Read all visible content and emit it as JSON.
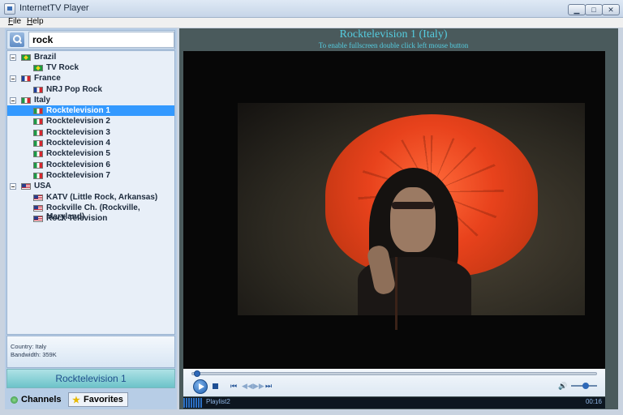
{
  "window": {
    "title": "InternetTV Player"
  },
  "menu": [
    "File",
    "Help"
  ],
  "search": {
    "value": "rock"
  },
  "tree": {
    "brazil": "Brazil",
    "tvrock": "TV Rock",
    "france": "France",
    "nrj": "NRJ Pop Rock",
    "italy": "Italy",
    "rt1": "Rocktelevision 1",
    "rt2": "Rocktelevision 2",
    "rt3": "Rocktelevision 3",
    "rt4": "Rocktelevision 4",
    "rt5": "Rocktelevision 5",
    "rt6": "Rocktelevision 6",
    "rt7": "Rocktelevision 7",
    "usa": "USA",
    "katv": "KATV (Little Rock, Arkansas)",
    "rockville": "Rockville Ch. (Rockville, Maryland)",
    "rocktv": "Rock Television"
  },
  "info": {
    "country": "Country: Italy",
    "bandwidth": "Bandwidth: 359K"
  },
  "now_playing": "Rocktelevision 1",
  "tabs": {
    "channels": "Channels",
    "favorites": "Favorites"
  },
  "player": {
    "title": "Rocktelevision 1 (Italy)",
    "hint": "To enable fullscreen double click left mouse button",
    "prev": "⏮",
    "rew": "◀◀",
    "ffw": "▶▶",
    "next": "⏭",
    "volume_icon": "🔊",
    "playlist": "Playlist2",
    "time": "00:16"
  },
  "colors": {
    "selection": "#3399ff",
    "title_text": "#55cde0",
    "now_playing_bg": "#6cc3c9"
  }
}
